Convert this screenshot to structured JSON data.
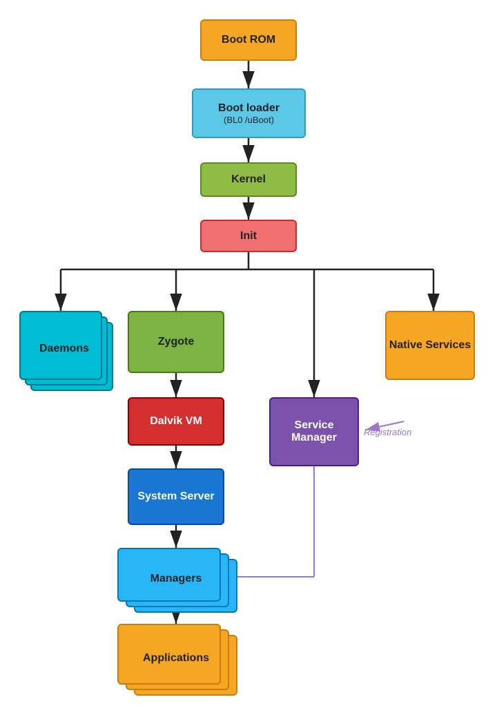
{
  "nodes": {
    "boot_rom": {
      "label": "Boot ROM"
    },
    "boot_loader": {
      "label": "Boot loader",
      "sublabel": "(BL0 /uBoot)"
    },
    "kernel": {
      "label": "Kernel"
    },
    "init": {
      "label": "Init"
    },
    "daemons": {
      "label": "Daemons"
    },
    "zygote": {
      "label": "Zygote"
    },
    "native_services": {
      "label": "Native Services"
    },
    "dalvik_vm": {
      "label": "Dalvik VM"
    },
    "service_manager": {
      "label": "Service Manager"
    },
    "system_server": {
      "label": "System Server"
    },
    "managers": {
      "label": "Managers"
    },
    "applications": {
      "label": "Applications"
    },
    "registration": {
      "label": "Registration"
    }
  }
}
